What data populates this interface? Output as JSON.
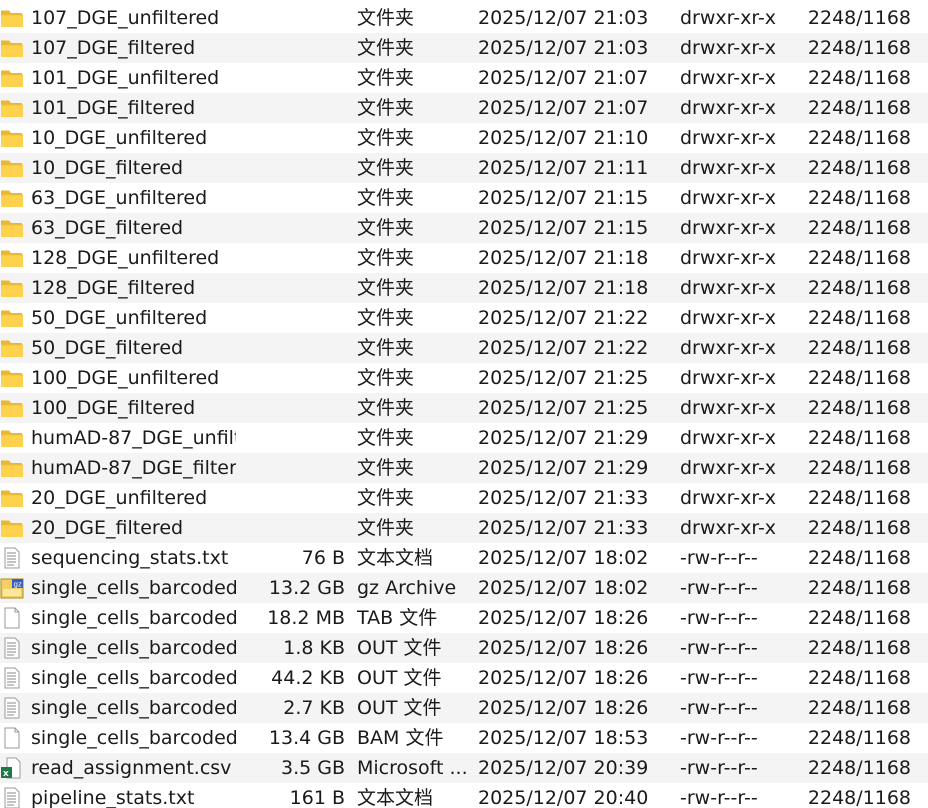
{
  "files": [
    {
      "icon": "folder-icon",
      "name": "107_DGE_unfiltered",
      "size": "",
      "type": "文件夹",
      "date": "2025/12/07 21:03",
      "perms": "drwxr-xr-x",
      "owner": "2248/1168"
    },
    {
      "icon": "folder-icon",
      "name": "107_DGE_filtered",
      "size": "",
      "type": "文件夹",
      "date": "2025/12/07 21:03",
      "perms": "drwxr-xr-x",
      "owner": "2248/1168"
    },
    {
      "icon": "folder-icon",
      "name": "101_DGE_unfiltered",
      "size": "",
      "type": "文件夹",
      "date": "2025/12/07 21:07",
      "perms": "drwxr-xr-x",
      "owner": "2248/1168"
    },
    {
      "icon": "folder-icon",
      "name": "101_DGE_filtered",
      "size": "",
      "type": "文件夹",
      "date": "2025/12/07 21:07",
      "perms": "drwxr-xr-x",
      "owner": "2248/1168"
    },
    {
      "icon": "folder-icon",
      "name": "10_DGE_unfiltered",
      "size": "",
      "type": "文件夹",
      "date": "2025/12/07 21:10",
      "perms": "drwxr-xr-x",
      "owner": "2248/1168"
    },
    {
      "icon": "folder-icon",
      "name": "10_DGE_filtered",
      "size": "",
      "type": "文件夹",
      "date": "2025/12/07 21:11",
      "perms": "drwxr-xr-x",
      "owner": "2248/1168"
    },
    {
      "icon": "folder-icon",
      "name": "63_DGE_unfiltered",
      "size": "",
      "type": "文件夹",
      "date": "2025/12/07 21:15",
      "perms": "drwxr-xr-x",
      "owner": "2248/1168"
    },
    {
      "icon": "folder-icon",
      "name": "63_DGE_filtered",
      "size": "",
      "type": "文件夹",
      "date": "2025/12/07 21:15",
      "perms": "drwxr-xr-x",
      "owner": "2248/1168"
    },
    {
      "icon": "folder-icon",
      "name": "128_DGE_unfiltered",
      "size": "",
      "type": "文件夹",
      "date": "2025/12/07 21:18",
      "perms": "drwxr-xr-x",
      "owner": "2248/1168"
    },
    {
      "icon": "folder-icon",
      "name": "128_DGE_filtered",
      "size": "",
      "type": "文件夹",
      "date": "2025/12/07 21:18",
      "perms": "drwxr-xr-x",
      "owner": "2248/1168"
    },
    {
      "icon": "folder-icon",
      "name": "50_DGE_unfiltered",
      "size": "",
      "type": "文件夹",
      "date": "2025/12/07 21:22",
      "perms": "drwxr-xr-x",
      "owner": "2248/1168"
    },
    {
      "icon": "folder-icon",
      "name": "50_DGE_filtered",
      "size": "",
      "type": "文件夹",
      "date": "2025/12/07 21:22",
      "perms": "drwxr-xr-x",
      "owner": "2248/1168"
    },
    {
      "icon": "folder-icon",
      "name": "100_DGE_unfiltered",
      "size": "",
      "type": "文件夹",
      "date": "2025/12/07 21:25",
      "perms": "drwxr-xr-x",
      "owner": "2248/1168"
    },
    {
      "icon": "folder-icon",
      "name": "100_DGE_filtered",
      "size": "",
      "type": "文件夹",
      "date": "2025/12/07 21:25",
      "perms": "drwxr-xr-x",
      "owner": "2248/1168"
    },
    {
      "icon": "folder-icon",
      "name": "humAD-87_DGE_unfilt...",
      "size": "",
      "type": "文件夹",
      "date": "2025/12/07 21:29",
      "perms": "drwxr-xr-x",
      "owner": "2248/1168"
    },
    {
      "icon": "folder-icon",
      "name": "humAD-87_DGE_filter...",
      "size": "",
      "type": "文件夹",
      "date": "2025/12/07 21:29",
      "perms": "drwxr-xr-x",
      "owner": "2248/1168"
    },
    {
      "icon": "folder-icon",
      "name": "20_DGE_unfiltered",
      "size": "",
      "type": "文件夹",
      "date": "2025/12/07 21:33",
      "perms": "drwxr-xr-x",
      "owner": "2248/1168"
    },
    {
      "icon": "folder-icon",
      "name": "20_DGE_filtered",
      "size": "",
      "type": "文件夹",
      "date": "2025/12/07 21:33",
      "perms": "drwxr-xr-x",
      "owner": "2248/1168"
    },
    {
      "icon": "text-file-icon",
      "name": "sequencing_stats.txt",
      "size": "76 B",
      "type": "文本文档",
      "date": "2025/12/07 18:02",
      "perms": "-rw-r--r--",
      "owner": "2248/1168"
    },
    {
      "icon": "gz-archive-icon",
      "name": "single_cells_barcoded...",
      "size": "13.2 GB",
      "type": "gz Archive",
      "date": "2025/12/07 18:02",
      "perms": "-rw-r--r--",
      "owner": "2248/1168"
    },
    {
      "icon": "blank-file-icon",
      "name": "single_cells_barcoded...",
      "size": "18.2 MB",
      "type": "TAB 文件",
      "date": "2025/12/07 18:26",
      "perms": "-rw-r--r--",
      "owner": "2248/1168"
    },
    {
      "icon": "text-file-icon",
      "name": "single_cells_barcoded...",
      "size": "1.8 KB",
      "type": "OUT 文件",
      "date": "2025/12/07 18:26",
      "perms": "-rw-r--r--",
      "owner": "2248/1168"
    },
    {
      "icon": "text-file-icon",
      "name": "single_cells_barcoded...",
      "size": "44.2 KB",
      "type": "OUT 文件",
      "date": "2025/12/07 18:26",
      "perms": "-rw-r--r--",
      "owner": "2248/1168"
    },
    {
      "icon": "text-file-icon",
      "name": "single_cells_barcoded...",
      "size": "2.7 KB",
      "type": "OUT 文件",
      "date": "2025/12/07 18:26",
      "perms": "-rw-r--r--",
      "owner": "2248/1168"
    },
    {
      "icon": "blank-file-icon",
      "name": "single_cells_barcoded...",
      "size": "13.4 GB",
      "type": "BAM 文件",
      "date": "2025/12/07 18:53",
      "perms": "-rw-r--r--",
      "owner": "2248/1168"
    },
    {
      "icon": "csv-file-icon",
      "name": "read_assignment.csv",
      "size": "3.5 GB",
      "type": "Microsoft ...",
      "date": "2025/12/07 20:39",
      "perms": "-rw-r--r--",
      "owner": "2248/1168"
    },
    {
      "icon": "text-file-icon",
      "name": "pipeline_stats.txt",
      "size": "161 B",
      "type": "文本文档",
      "date": "2025/12/07 20:40",
      "perms": "-rw-r--r--",
      "owner": "2248/1168"
    }
  ]
}
